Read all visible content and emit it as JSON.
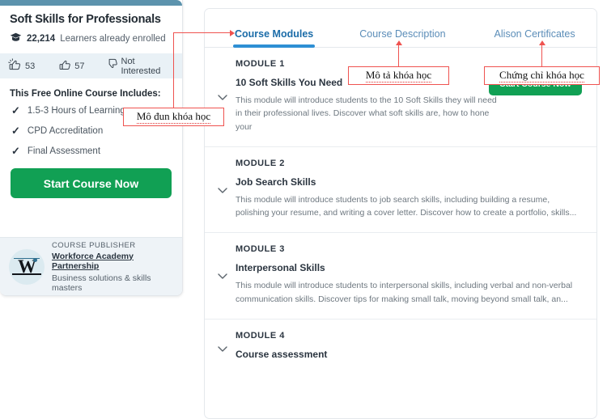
{
  "left_card": {
    "course_title": "Soft Skills for Professionals",
    "enrolled_count": "22,214",
    "enrolled_label": "Learners already enrolled",
    "reactions": [
      {
        "icon": "celebrate-thumbs-up-icon",
        "value": "53"
      },
      {
        "icon": "thumbs-up-icon",
        "value": "57"
      },
      {
        "icon": "thumbs-down-icon",
        "value": "Not Interested"
      }
    ],
    "includes_title": "This Free Online Course Includes:",
    "includes": [
      {
        "check": "✓",
        "text": "1.5-3 Hours of Learning"
      },
      {
        "check": "✓",
        "text": "CPD Accreditation"
      },
      {
        "check": "✓",
        "text": "Final Assessment"
      }
    ],
    "start_button": "Start Course Now",
    "publisher": {
      "kicker": "COURSE PUBLISHER",
      "name": "Workforce Academy Partnership",
      "subtitle": "Business solutions & skills masters",
      "logo_letter": "W"
    }
  },
  "right_panel": {
    "tabs": [
      {
        "label": "Course Modules",
        "active": true
      },
      {
        "label": "Course Description",
        "active": false
      },
      {
        "label": "Alison Certificates",
        "active": false
      }
    ],
    "start_button": "Start Course Now",
    "modules": [
      {
        "number": "MODULE 1",
        "title": "10 Soft Skills You Need",
        "description": "This module will introduce students to the 10 Soft Skills they will need in their professional lives. Discover what soft skills are, how to hone your"
      },
      {
        "number": "MODULE 2",
        "title": "Job Search Skills",
        "description": "This module will introduce students to job search skills, including building a resume, polishing your resume, and writing a cover letter. Discover how to create a portfolio, skills..."
      },
      {
        "number": "MODULE 3",
        "title": "Interpersonal Skills",
        "description": "This module will introduce students to interpersonal skills, including verbal and non-verbal communication skills. Discover tips for making small talk, moving beyond small talk, an..."
      },
      {
        "number": "MODULE 4",
        "title": "Course assessment",
        "description": ""
      }
    ]
  },
  "annotations": {
    "modules_label": "Mô đun khóa học",
    "description_label": "Mô tả khóa học",
    "certificates_label": "Chứng chỉ khóa học",
    "color": "#ef5350"
  }
}
